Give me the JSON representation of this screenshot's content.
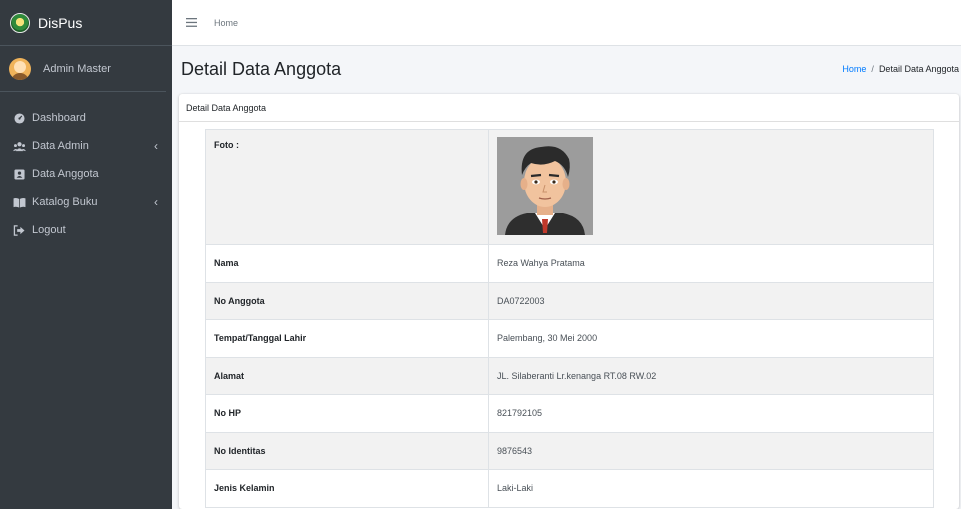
{
  "brand": {
    "name": "DisPus"
  },
  "user": {
    "name": "Admin Master"
  },
  "sidebar": {
    "items": [
      {
        "label": "Dashboard",
        "icon": "dashboard-icon"
      },
      {
        "label": "Data Admin",
        "icon": "users-icon",
        "has_submenu": true
      },
      {
        "label": "Data Anggota",
        "icon": "id-card-icon"
      },
      {
        "label": "Katalog Buku",
        "icon": "book-icon",
        "has_submenu": true
      },
      {
        "label": "Logout",
        "icon": "logout-icon"
      }
    ]
  },
  "topbar": {
    "home_link": "Home"
  },
  "header": {
    "title": "Detail Data Anggota",
    "breadcrumb": {
      "home": "Home",
      "separator": "/",
      "current": "Detail Data Anggota"
    }
  },
  "card": {
    "title": "Detail Data Anggota",
    "photo_label": "Foto :",
    "rows": [
      {
        "label": "Nama",
        "value": "Reza Wahya Pratama"
      },
      {
        "label": "No Anggota",
        "value": "DA0722003"
      },
      {
        "label": "Tempat/Tanggal Lahir",
        "value": "Palembang, 30 Mei 2000"
      },
      {
        "label": "Alamat",
        "value": "JL. Silaberanti Lr.kenanga RT.08 RW.02"
      },
      {
        "label": "No HP",
        "value": "821792105"
      },
      {
        "label": "No Identitas",
        "value": "9876543"
      },
      {
        "label": "Jenis Kelamin",
        "value": "Laki-Laki"
      }
    ]
  },
  "colors": {
    "sidebar_bg": "#343a40",
    "link": "#007bff",
    "page_bg": "#f4f6f9",
    "stripe": "#f2f2f2"
  }
}
